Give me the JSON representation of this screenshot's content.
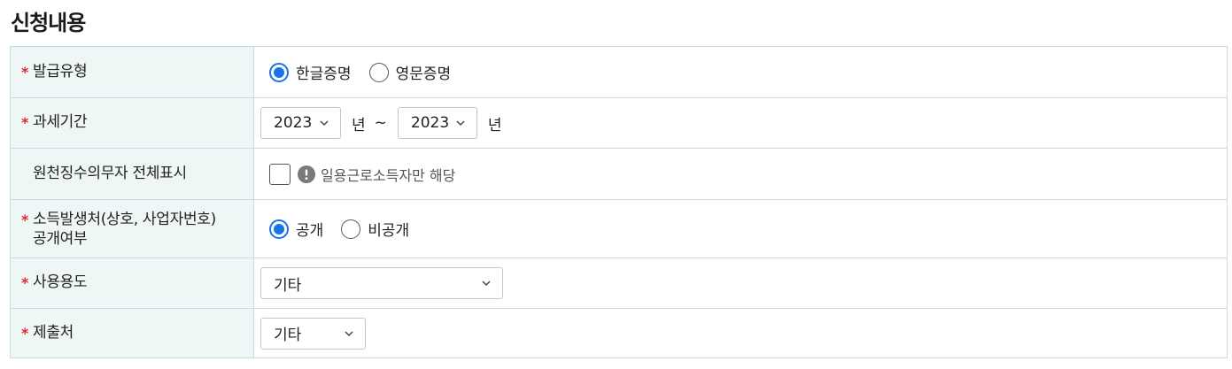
{
  "page": {
    "title": "신청내용"
  },
  "rows": {
    "issue_type": {
      "label": "발급유형",
      "required": true,
      "options": [
        {
          "label": "한글증명",
          "selected": true
        },
        {
          "label": "영문증명",
          "selected": false
        }
      ]
    },
    "tax_period": {
      "label": "과세기간",
      "required": true,
      "from_year": "2023",
      "to_year": "2023",
      "unit": "년",
      "separator": "~"
    },
    "withholding": {
      "label": "원천징수의무자 전체표시",
      "required": false,
      "checked": false,
      "hint": "일용근로소득자만 해당"
    },
    "disclosure": {
      "label": "소득발생처(상호, 사업자번호)\n공개여부",
      "required": true,
      "options": [
        {
          "label": "공개",
          "selected": true
        },
        {
          "label": "비공개",
          "selected": false
        }
      ]
    },
    "purpose": {
      "label": "사용용도",
      "required": true,
      "value": "기타"
    },
    "submit_to": {
      "label": "제출처",
      "required": true,
      "value": "기타"
    }
  },
  "colors": {
    "accent": "#1a73e8",
    "required_mark": "#e0263a",
    "label_bg": "#eef7f6",
    "border": "#c9dbe2"
  },
  "icons": {
    "required": "asterisk-icon",
    "dropdown": "chevron-down-icon",
    "info": "exclamation-circle-icon"
  }
}
